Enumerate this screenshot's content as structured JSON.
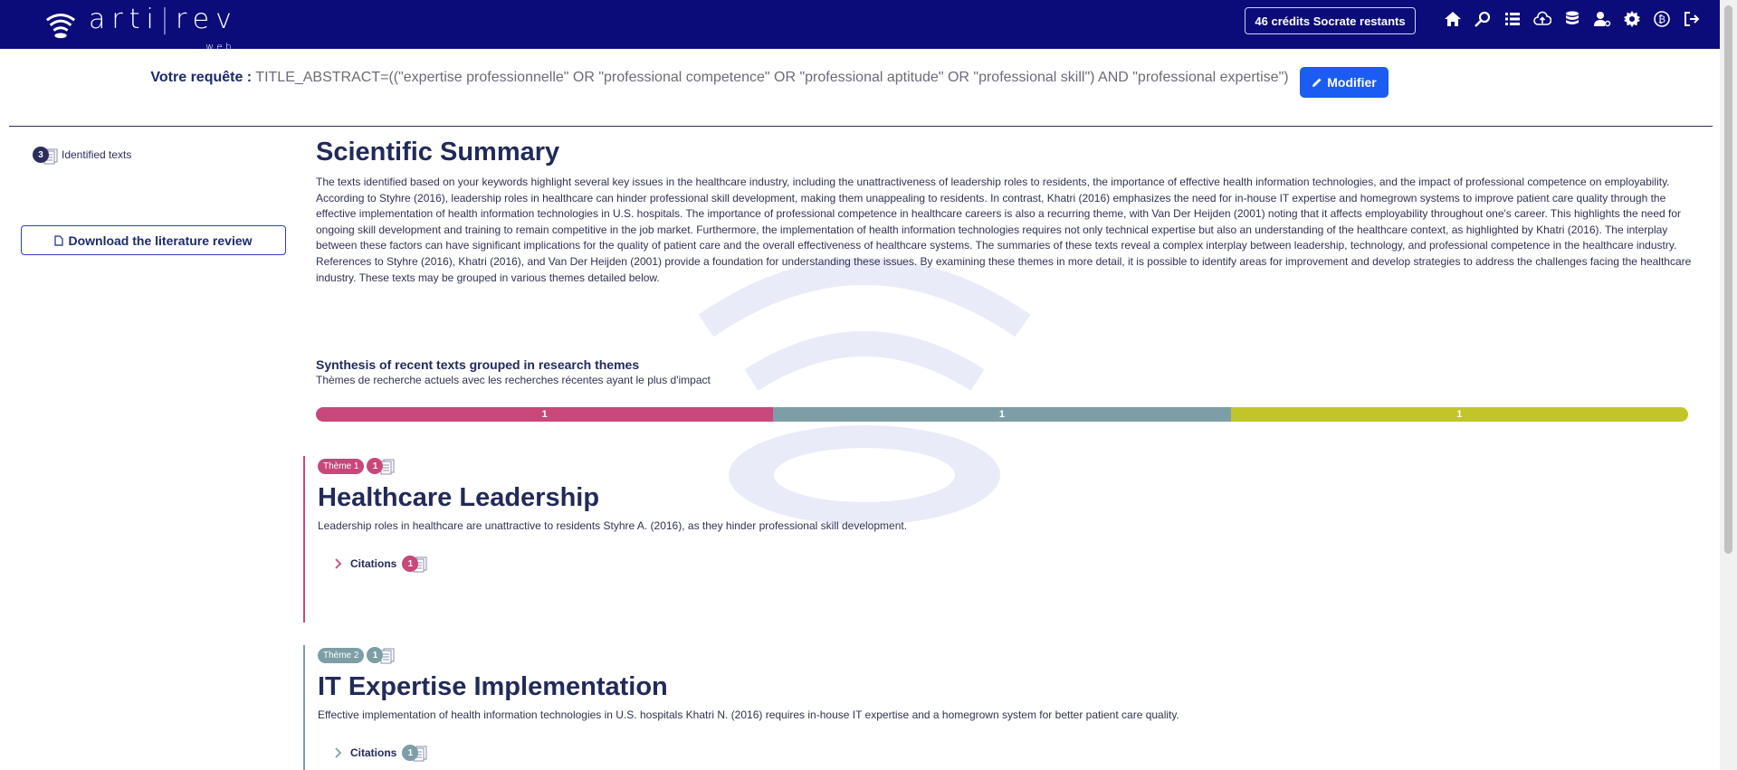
{
  "header": {
    "logo": {
      "text_left": "arti",
      "text_right": "rev",
      "sub": "web"
    },
    "credits_label": "46 crédits Socrate restants",
    "nav_icons": [
      "home-icon",
      "search-icon",
      "list-icon",
      "cloud-upload-icon",
      "database-icon",
      "user-cog-icon",
      "settings-icon",
      "bitcoin-icon",
      "logout-icon"
    ]
  },
  "query": {
    "label": "Votre requête :",
    "text": "TITLE_ABSTRACT=((\"expertise professionnelle\" OR \"professional competence\" OR \"professional aptitude\" OR \"professional skill\") AND \"professional expertise\")",
    "modify_label": "Modifier"
  },
  "sidebar": {
    "identified_count": "3",
    "identified_label": "Identified texts",
    "download_label": "Download the literature review"
  },
  "summary": {
    "title": "Scientific Summary",
    "text": "The texts identified based on your keywords highlight several key issues in the healthcare industry, including the unattractiveness of leadership roles to residents, the importance of effective health information technologies, and the impact of professional competence on employability. According to Styhre (2016), leadership roles in healthcare can hinder professional skill development, making them unappealing to residents. In contrast, Khatri (2016) emphasizes the need for in-house IT expertise and homegrown systems to improve patient care quality through the effective implementation of health information technologies in U.S. hospitals. The importance of professional competence in healthcare careers is also a recurring theme, with Van Der Heijden (2001) noting that it affects employability throughout one's career. This highlights the need for ongoing skill development and training to remain competitive in the job market. Furthermore, the implementation of health information technologies requires not only technical expertise but also an understanding of the healthcare context, as highlighted by Khatri (2016). The interplay between these factors can have significant implications for the quality of patient care and the overall effectiveness of healthcare systems. The summaries of these texts reveal a complex interplay between leadership, technology, and professional competence in the healthcare industry. References to Styhre (2016), Khatri (2016), and Van Der Heijden (2001) provide a foundation for understanding these issues. By examining these themes in more detail, it is possible to identify areas for improvement and develop strategies to address the challenges facing the healthcare industry. These texts may be grouped in various themes detailed below."
  },
  "synthesis": {
    "title": "Synthesis of recent texts grouped in research themes",
    "subtitle": "Thèmes de recherche actuels avec les recherches récentes ayant le plus d'impact",
    "segments": [
      {
        "value": "1",
        "color": "#c9477a"
      },
      {
        "value": "1",
        "color": "#7d9ea6"
      },
      {
        "value": "1",
        "color": "#c2c52a"
      }
    ]
  },
  "themes": [
    {
      "pill": "Thème 1",
      "count": "1",
      "color": "#c9477a",
      "title": "Healthcare Leadership",
      "text": "Leadership roles in healthcare are unattractive to residents Styhre A. (2016), as they hinder professional skill development.",
      "citations_label": "Citations",
      "citations_count": "1"
    },
    {
      "pill": "Thème 2",
      "count": "1",
      "color": "#7d9ea6",
      "title": "IT Expertise Implementation",
      "text": "Effective implementation of health information technologies in U.S. hospitals Khatri N. (2016) requires in-house IT expertise and a homegrown system for better patient care quality.",
      "citations_label": "Citations",
      "citations_count": "1"
    }
  ]
}
